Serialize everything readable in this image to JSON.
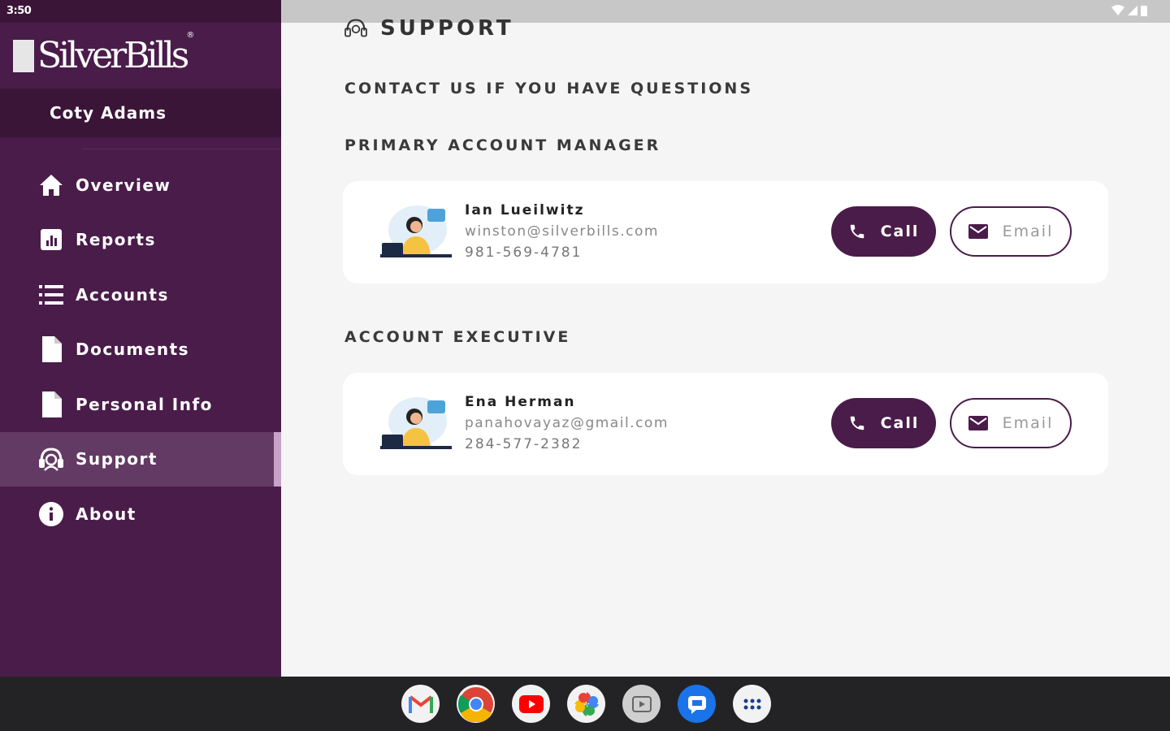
{
  "status_bar": {
    "time": "3:50"
  },
  "sidebar": {
    "brand": "SilverBills",
    "brand_tm": "®",
    "user_name": "Coty Adams",
    "items": [
      {
        "label": "Overview",
        "icon": "home-icon"
      },
      {
        "label": "Reports",
        "icon": "chart-icon"
      },
      {
        "label": "Accounts",
        "icon": "list-icon"
      },
      {
        "label": "Documents",
        "icon": "document-icon"
      },
      {
        "label": "Personal Info",
        "icon": "document-icon"
      },
      {
        "label": "Support",
        "icon": "headset-icon",
        "active": true
      },
      {
        "label": "About",
        "icon": "info-icon"
      }
    ]
  },
  "main": {
    "title": "SUPPORT",
    "subtitle": "CONTACT US IF YOU HAVE QUESTIONS",
    "sections": [
      {
        "heading": "PRIMARY ACCOUNT MANAGER",
        "contact": {
          "name": "Ian Lueilwitz",
          "email": "winston@silverbills.com",
          "phone": "981-569-4781"
        }
      },
      {
        "heading": "ACCOUNT EXECUTIVE",
        "contact": {
          "name": "Ena Herman",
          "email": "panahovayaz@gmail.com",
          "phone": "284-577-2382"
        }
      }
    ],
    "call_label": "Call",
    "email_label": "Email"
  },
  "taskbar": {
    "apps": [
      "gmail-icon",
      "chrome-icon",
      "youtube-icon",
      "photos-icon",
      "tv-icon",
      "messages-icon",
      "app-drawer-icon"
    ]
  },
  "colors": {
    "brand": "#4a1c4a",
    "brand_dark": "#3a1538",
    "accent": "#c8a2c8"
  }
}
